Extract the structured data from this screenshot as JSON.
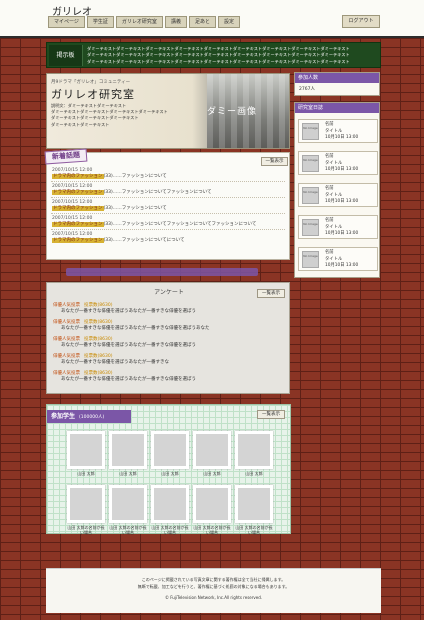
{
  "header": {
    "logo": "ガリレオ",
    "nav": [
      "マイページ",
      "学生証",
      "ガリレオ研究室",
      "講義",
      "足あと",
      "設定"
    ],
    "logout": "ログアウト"
  },
  "bulletin": {
    "label": "掲示板",
    "lines": [
      "ダミーテキストダミーテキストダミーテキストダミーテキストダミーテキストダミーテキストダミーテキストダミーテキストダミーテキスト",
      "ダミーテキストダミーテキストダミーテキストダミーテキストダミーテキストダミーテキストダミーテキストダミーテキストダミーテキスト",
      "ダミーテキストダミーテキストダミーテキストダミーテキストダミーテキストダミーテキストダミーテキストダミーテキストダミーテキスト"
    ]
  },
  "hero": {
    "subtitle": "月9ドラマ「ガリレオ」コミュニティー",
    "title": "ガリレオ研究室",
    "image_label": "ダミー画像",
    "desc": [
      "説明文：ダミーテキストダミーテキスト",
      "ダミーテキストダミーテキストダミーテキストダミーテキスト",
      "ダミーテキストダミーテキストダミーテキスト",
      "ダミーテキストダミーテキスト"
    ]
  },
  "news": {
    "label": "新着話題",
    "more": "一覧表示",
    "items": [
      {
        "date": "2007/10/15 12:00",
        "cat": "ドラマ内のファッション",
        "count": "(33)",
        "text": "……ファッションについて"
      },
      {
        "date": "2007/10/15 12:00",
        "cat": "ドラマ内のファッション",
        "count": "(33)",
        "text": "……ファッションについてファッションについて"
      },
      {
        "date": "2007/10/15 12:00",
        "cat": "ドラマ内のファッション",
        "count": "(33)",
        "text": "……ファッションについて"
      },
      {
        "date": "2007/10/15 12:00",
        "cat": "ドラマ内のファッション",
        "count": "(33)",
        "text": "……ファッションについてファッションについてファッションについて"
      },
      {
        "date": "2007/10/15 12:00",
        "cat": "ドラマ内のファッション",
        "count": "(33)",
        "text": "……ファッションについてについて"
      }
    ]
  },
  "survey": {
    "label": "アンケート",
    "more": "一覧表示",
    "items": [
      {
        "name": "俳優人気投票",
        "count": "投票数(8630)",
        "text": "あなたが一番すきな俳優を選ぼうあなたが一番すきな俳優を選ぼう"
      },
      {
        "name": "俳優人気投票",
        "count": "投票数(8630)",
        "text": "あなたが一番すきな俳優を選ぼうあなたが一番すきな俳優を選ぼうあなた"
      },
      {
        "name": "俳優人気投票",
        "count": "投票数(8630)",
        "text": "あなたが一番すきな俳優を選ぼうあなたが一番すきな俳優を選ぼう"
      },
      {
        "name": "俳優人気投票",
        "count": "投票数(8630)",
        "text": "あなたが一番すきな俳優を選ぼうあなたが一番すきな"
      },
      {
        "name": "俳優人気投票",
        "count": "投票数(8630)",
        "text": "あなたが一番すきな俳優を選ぼうあなたが一番すきな俳優を選ぼう"
      }
    ]
  },
  "members": {
    "label": "参加学生",
    "count": "(100000人)",
    "more": "一覧表示",
    "row1": [
      "山田 太郎",
      "山田 太郎",
      "山田 太郎",
      "山田 太郎",
      "山田 太郎"
    ],
    "row2": [
      "山田 太郎の名前が長い場合",
      "山田 太郎の名前が長い場合",
      "山田 太郎の名前が長い場合",
      "山田 太郎の名前が長い場合",
      "山田 太郎の名前が長い場合"
    ]
  },
  "sidebar": {
    "participants_label": "参加人数",
    "participants_count": "2767人",
    "diary_label": "研究室日誌",
    "diary": [
      {
        "img": "No Image",
        "name": "名前",
        "title": "タイトル",
        "date": "10月10日 13:00"
      },
      {
        "img": "No Image",
        "name": "名前",
        "title": "タイトル",
        "date": "10月10日 13:00"
      },
      {
        "img": "No Image",
        "name": "名前",
        "title": "タイトル",
        "date": "10月10日 13:00"
      },
      {
        "img": "No Image",
        "name": "名前",
        "title": "タイトル",
        "date": "10月10日 13:00"
      },
      {
        "img": "No Image",
        "name": "名前",
        "title": "タイトル",
        "date": "10月10日 13:00"
      }
    ]
  },
  "footer": {
    "line1": "このページに掲載されている写真文章に関する著作権は全て当社に帰属します。",
    "line2": "無断で転載、加工などを行うと、著作権に基づく処罰の対象になる場合もあります。",
    "copyright": "© FujiTelevision Network, Inc.All rights reserved."
  }
}
